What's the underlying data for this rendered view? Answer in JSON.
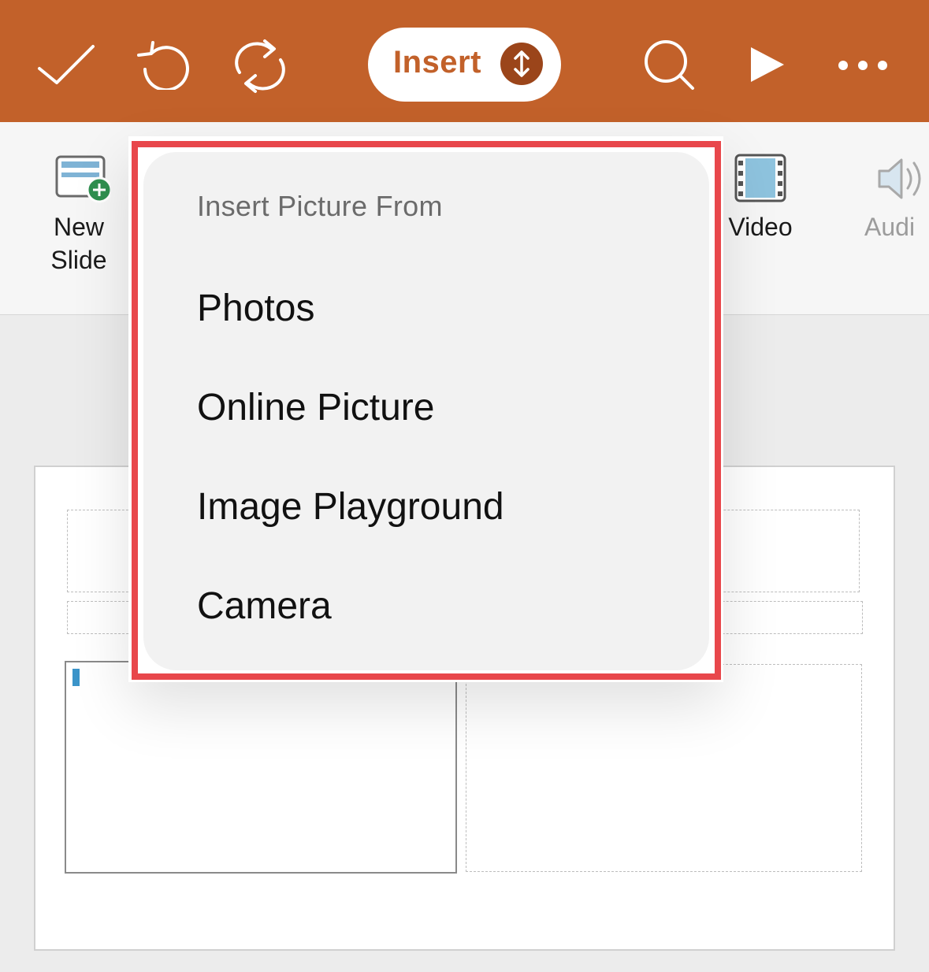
{
  "toolbar": {
    "done_icon": "checkmark-icon",
    "undo_icon": "undo-icon",
    "sync_icon": "sync-icon",
    "tab_label": "Insert",
    "tab_switch_icon": "up-down-arrows-icon",
    "search_icon": "search-icon",
    "play_icon": "play-icon",
    "more_icon": "ellipsis-icon",
    "bar_color": "#c2612a"
  },
  "ribbon": {
    "items": [
      {
        "label_line1": "New",
        "label_line2": "Slide",
        "icon": "new-slide-icon"
      },
      {
        "label": "Video",
        "icon": "video-icon"
      },
      {
        "label": "Audi",
        "icon": "audio-icon",
        "disabled": true
      }
    ]
  },
  "popover": {
    "header": "Insert Picture From",
    "items": [
      {
        "label": "Photos"
      },
      {
        "label": "Online Picture"
      },
      {
        "label": "Image Playground"
      },
      {
        "label": "Camera"
      }
    ],
    "highlight_color": "#e8474b"
  }
}
